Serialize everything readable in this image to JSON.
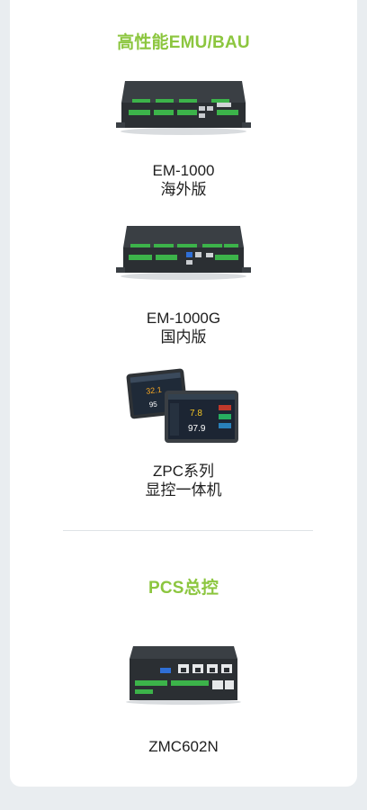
{
  "sections": [
    {
      "title": "高性能EMU/BAU",
      "products": [
        {
          "name": "EM-1000",
          "subtitle": "海外版"
        },
        {
          "name": "EM-1000G",
          "subtitle": "国内版"
        },
        {
          "name": "ZPC系列",
          "subtitle": "显控一体机",
          "screen_values": [
            "32.1",
            "95",
            "7.8",
            "97.9"
          ]
        }
      ]
    },
    {
      "title": "PCS总控",
      "products": [
        {
          "name": "ZMC602N"
        }
      ]
    }
  ],
  "colors": {
    "accent": "#8cc63f",
    "background": "#e9edf0",
    "card": "#ffffff",
    "text": "#1e1e1e"
  }
}
